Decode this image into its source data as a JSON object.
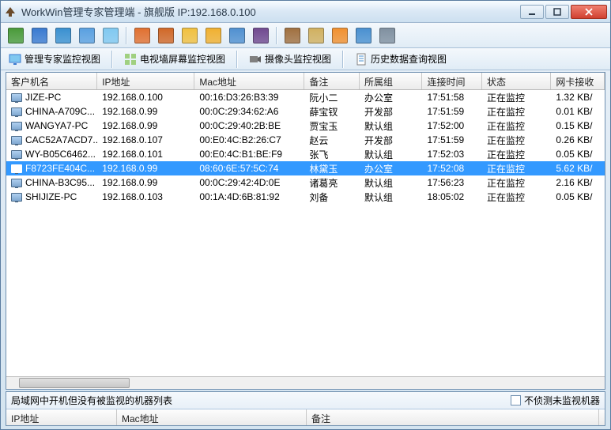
{
  "title": "WorkWin管理专家管理端 - 旗舰版 IP:192.168.0.100",
  "tabs": [
    {
      "label": "管理专家监控视图"
    },
    {
      "label": "电视墙屏幕监控视图"
    },
    {
      "label": "摄像头监控视图"
    },
    {
      "label": "历史数据查询视图"
    }
  ],
  "columns": {
    "name": "客户机名",
    "ip": "IP地址",
    "mac": "Mac地址",
    "note": "备注",
    "group": "所属组",
    "time": "连接时间",
    "status": "状态",
    "net": "网卡接收"
  },
  "rows": [
    {
      "name": "JIZE-PC",
      "ip": "192.168.0.100",
      "mac": "00:16:D3:26:B3:39",
      "note": "阮小二",
      "group": "办公室",
      "time": "17:51:58",
      "status": "正在监控",
      "net": "1.32 KB/",
      "sel": false
    },
    {
      "name": "CHINA-A709C...",
      "ip": "192.168.0.99",
      "mac": "00:0C:29:34:62:A6",
      "note": "薛宝钗",
      "group": "开发部",
      "time": "17:51:59",
      "status": "正在监控",
      "net": "0.01 KB/",
      "sel": false
    },
    {
      "name": "WANGYA7-PC",
      "ip": "192.168.0.99",
      "mac": "00:0C:29:40:2B:BE",
      "note": "贾宝玉",
      "group": "默认组",
      "time": "17:52:00",
      "status": "正在监控",
      "net": "0.15 KB/",
      "sel": false
    },
    {
      "name": "CAC52A7ACD7...",
      "ip": "192.168.0.107",
      "mac": "00:E0:4C:B2:26:C7",
      "note": "赵云",
      "group": "开发部",
      "time": "17:51:59",
      "status": "正在监控",
      "net": "0.26 KB/",
      "sel": false
    },
    {
      "name": "WY-B05C6462...",
      "ip": "192.168.0.101",
      "mac": "00:E0:4C:B1:BE:F9",
      "note": "张飞",
      "group": "默认组",
      "time": "17:52:03",
      "status": "正在监控",
      "net": "0.05 KB/",
      "sel": false
    },
    {
      "name": "F8723FE404C...",
      "ip": "192.168.0.99",
      "mac": "08:60:6E:57:5C:74",
      "note": "林黛玉",
      "group": "办公室",
      "time": "17:52:08",
      "status": "正在监控",
      "net": "5.62 KB/",
      "sel": true
    },
    {
      "name": "CHINA-B3C95...",
      "ip": "192.168.0.99",
      "mac": "00:0C:29:42:4D:0E",
      "note": "诸葛亮",
      "group": "默认组",
      "time": "17:56:23",
      "status": "正在监控",
      "net": "2.16 KB/",
      "sel": false
    },
    {
      "name": "SHIJIZE-PC",
      "ip": "192.168.0.103",
      "mac": "00:1A:4D:6B:81:92",
      "note": "刘备",
      "group": "默认组",
      "time": "18:05:02",
      "status": "正在监控",
      "net": "0.05 KB/",
      "sel": false
    }
  ],
  "bottom_label": "局域网中开机但没有被监视的机器列表",
  "bottom_checkbox": "不侦测未监视机器",
  "bottom_cols": {
    "ip": "IP地址",
    "mac": "Mac地址",
    "note": "备注"
  },
  "toolbar_icons": [
    "monitor-icon",
    "screen-icon",
    "display-icon",
    "window-icon",
    "globe-icon",
    "refresh-icon",
    "sync-icon",
    "folder-icon",
    "chat-icon",
    "shield-icon",
    "film-icon",
    "gear-icon",
    "disc-icon",
    "user-orange-icon",
    "user-blue-icon",
    "wrench-icon"
  ],
  "toolbar_colors": [
    "#4a9a3a",
    "#3a7ad0",
    "#3a90d0",
    "#5aa0e0",
    "#80c8f0",
    "#e07030",
    "#d06828",
    "#f0c040",
    "#f0b030",
    "#5090d0",
    "#704a90",
    "#a07040",
    "#d0b060",
    "#f09030",
    "#4a90d0",
    "#8090a0"
  ]
}
